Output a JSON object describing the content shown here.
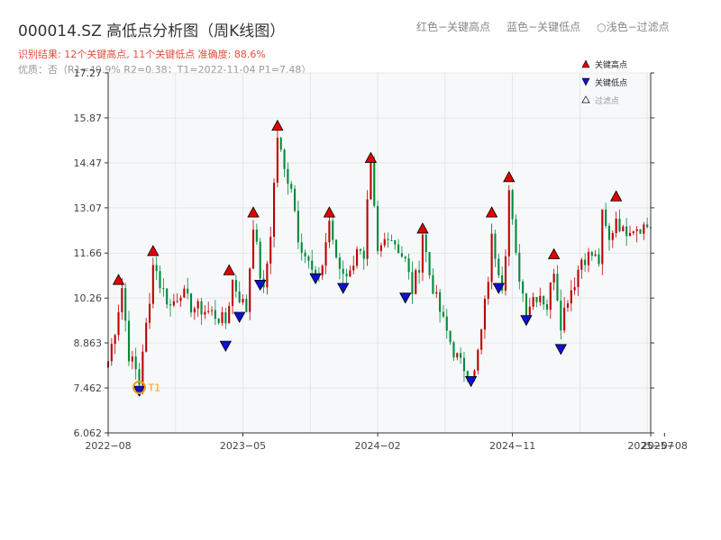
{
  "header": {
    "title": "000014.SZ 高低点分析图（周K线图）",
    "legend_hint_red": "红色−关键高点",
    "legend_hint_blue": "蓝色−关键低点",
    "legend_hint_light": "○浅色−过滤点",
    "result_line": "识别结果: 12个关键高点, 11个关键低点  准确度: 88.6%",
    "quality_line": "优质：否（R1=40.9%  R2=0.38；T1=2022-11-04 P1=7.48）"
  },
  "legend": {
    "high_label": "关键高点",
    "low_label": "关键低点",
    "filtered_label": "过滤点"
  },
  "colors": {
    "up": "#c00000",
    "down": "#008a3a",
    "high_marker": "#e00000",
    "low_marker": "#1010d0",
    "t1_circle": "#f39c12",
    "plot_bg": "#f6f8fa",
    "grid": "#dfe3e8"
  },
  "chart_data": {
    "type": "candlestick",
    "xlim": [
      0,
      157
    ],
    "ylim": [
      6.062,
      17.27
    ],
    "y_ticks": [
      6.062,
      7.462,
      8.863,
      10.26,
      11.66,
      13.07,
      14.47,
      15.87,
      17.27
    ],
    "y_tick_labels": [
      "6.062",
      "7.462",
      "8.863",
      "10.26",
      "11.66",
      "13.07",
      "14.47",
      "15.87",
      "17.27"
    ],
    "x_tick_labels": [
      {
        "label": "2022−08",
        "x": 0
      },
      {
        "label": "2023−05",
        "x": 39
      },
      {
        "label": "2024−02",
        "x": 78
      },
      {
        "label": "2024−11",
        "x": 117
      },
      {
        "label": "2025−07",
        "x": 157
      },
      {
        "label": "2025−08",
        "x": 161
      }
    ],
    "anchors": [
      [
        0,
        8.3
      ],
      [
        2,
        9.3
      ],
      [
        4,
        10.6
      ],
      [
        6,
        8.5
      ],
      [
        8,
        8.0
      ],
      [
        9,
        7.6
      ],
      [
        10,
        8.7
      ],
      [
        12,
        10.0
      ],
      [
        13,
        11.5
      ],
      [
        15,
        10.7
      ],
      [
        18,
        10.0
      ],
      [
        21,
        10.5
      ],
      [
        24,
        10.0
      ],
      [
        27,
        9.9
      ],
      [
        30,
        9.8
      ],
      [
        34,
        9.5
      ],
      [
        36,
        10.8
      ],
      [
        38,
        10.3
      ],
      [
        40,
        9.9
      ],
      [
        42,
        12.6
      ],
      [
        44,
        11.0
      ],
      [
        45,
        10.4
      ],
      [
        47,
        12.3
      ],
      [
        49,
        15.3
      ],
      [
        51,
        14.2
      ],
      [
        53,
        13.8
      ],
      [
        55,
        12.2
      ],
      [
        57,
        11.6
      ],
      [
        60,
        10.8
      ],
      [
        62,
        11.3
      ],
      [
        64,
        12.7
      ],
      [
        65,
        11.9
      ],
      [
        67,
        11.2
      ],
      [
        70,
        11.0
      ],
      [
        72,
        11.9
      ],
      [
        74,
        11.3
      ],
      [
        75,
        13.1
      ],
      [
        76,
        14.3
      ],
      [
        78,
        11.6
      ],
      [
        81,
        12.3
      ],
      [
        83,
        12.0
      ],
      [
        86,
        11.4
      ],
      [
        88,
        10.5
      ],
      [
        90,
        11.3
      ],
      [
        91,
        12.3
      ],
      [
        93,
        11.0
      ],
      [
        95,
        10.2
      ],
      [
        97,
        9.5
      ],
      [
        100,
        8.6
      ],
      [
        102,
        8.2
      ],
      [
        104,
        8.0
      ],
      [
        106,
        7.9
      ],
      [
        108,
        9.2
      ],
      [
        110,
        10.9
      ],
      [
        111,
        12.1
      ],
      [
        113,
        11.2
      ],
      [
        114,
        10.7
      ],
      [
        115,
        11.8
      ],
      [
        116,
        13.6
      ],
      [
        118,
        11.5
      ],
      [
        120,
        10.4
      ],
      [
        121,
        9.9
      ],
      [
        123,
        10.3
      ],
      [
        125,
        10.4
      ],
      [
        127,
        10.0
      ],
      [
        129,
        11.2
      ],
      [
        131,
        9.5
      ],
      [
        133,
        10.3
      ],
      [
        135,
        10.8
      ],
      [
        137,
        11.5
      ],
      [
        140,
        11.6
      ],
      [
        142,
        11.4
      ],
      [
        143,
        12.8
      ],
      [
        145,
        12.0
      ],
      [
        147,
        12.8
      ],
      [
        149,
        12.3
      ],
      [
        151,
        12.5
      ]
    ],
    "key_highs": [
      {
        "x": 3,
        "y": 10.6
      },
      {
        "x": 13,
        "y": 11.5
      },
      {
        "x": 35,
        "y": 10.9
      },
      {
        "x": 42,
        "y": 12.7
      },
      {
        "x": 49,
        "y": 15.4
      },
      {
        "x": 64,
        "y": 12.7
      },
      {
        "x": 76,
        "y": 14.4
      },
      {
        "x": 91,
        "y": 12.2
      },
      {
        "x": 111,
        "y": 12.7
      },
      {
        "x": 116,
        "y": 13.8
      },
      {
        "x": 129,
        "y": 11.4
      },
      {
        "x": 147,
        "y": 13.2
      }
    ],
    "key_lows": [
      {
        "x": 9,
        "y": 7.6
      },
      {
        "x": 34,
        "y": 9.0
      },
      {
        "x": 38,
        "y": 9.9
      },
      {
        "x": 44,
        "y": 10.9
      },
      {
        "x": 60,
        "y": 11.1
      },
      {
        "x": 68,
        "y": 10.8
      },
      {
        "x": 86,
        "y": 10.5
      },
      {
        "x": 105,
        "y": 7.9
      },
      {
        "x": 113,
        "y": 10.8
      },
      {
        "x": 121,
        "y": 9.8
      },
      {
        "x": 131,
        "y": 8.9
      }
    ],
    "t1_point": {
      "x": 9,
      "y": 7.48,
      "label": "T1"
    }
  }
}
